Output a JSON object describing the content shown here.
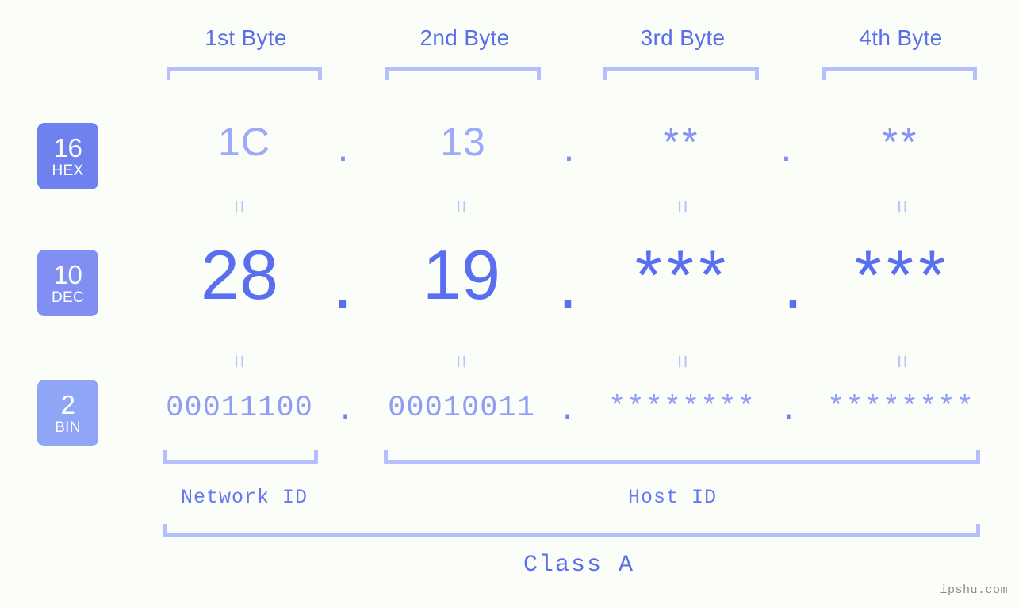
{
  "background": "#fbfdf8",
  "accent": "#5a6ff0",
  "headers": [
    {
      "label": "1st Byte"
    },
    {
      "label": "2nd Byte"
    },
    {
      "label": "3rd Byte"
    },
    {
      "label": "4th Byte"
    }
  ],
  "rows": {
    "hex": {
      "badge_number": "16",
      "badge_word": "HEX",
      "badge_color": "#6e81ef",
      "values": [
        "1C",
        "13",
        "**",
        "**"
      ],
      "separator": "."
    },
    "dec": {
      "badge_number": "10",
      "badge_word": "DEC",
      "badge_color": "#808ff1",
      "values": [
        "28",
        "19",
        "***",
        "***"
      ],
      "separator": "."
    },
    "bin": {
      "badge_number": "2",
      "badge_word": "BIN",
      "badge_color": "#8fa5f6",
      "values": [
        "00011100",
        "00010011",
        "********",
        "********"
      ],
      "separator": "."
    }
  },
  "equals_symbol": "=",
  "sections": {
    "network_id": "Network ID",
    "host_id": "Host ID"
  },
  "class_label": "Class A",
  "watermark": "ipshu.com"
}
